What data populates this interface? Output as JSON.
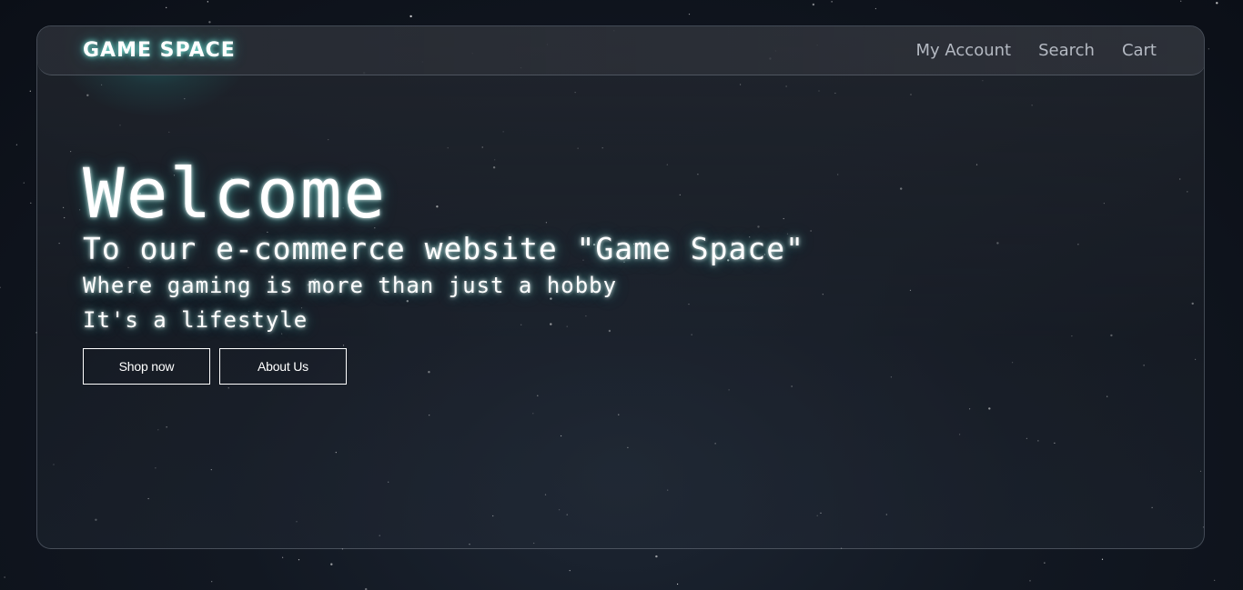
{
  "nav": {
    "logo": "GAME SPACE",
    "links": [
      "My Account",
      "Search",
      "Cart"
    ]
  },
  "hero": {
    "heading": "Welcome",
    "subheading": "To our e-commerce website \"Game Space\"",
    "tagline_line1": "Where gaming is more than just a hobby",
    "tagline_line2": "It's a lifestyle",
    "buttons": {
      "shop": "Shop now",
      "about": "About Us"
    }
  },
  "colors": {
    "accent_glow": "#3cd2c8",
    "text": "#ffffff",
    "nav_text": "#b4b9c2"
  }
}
